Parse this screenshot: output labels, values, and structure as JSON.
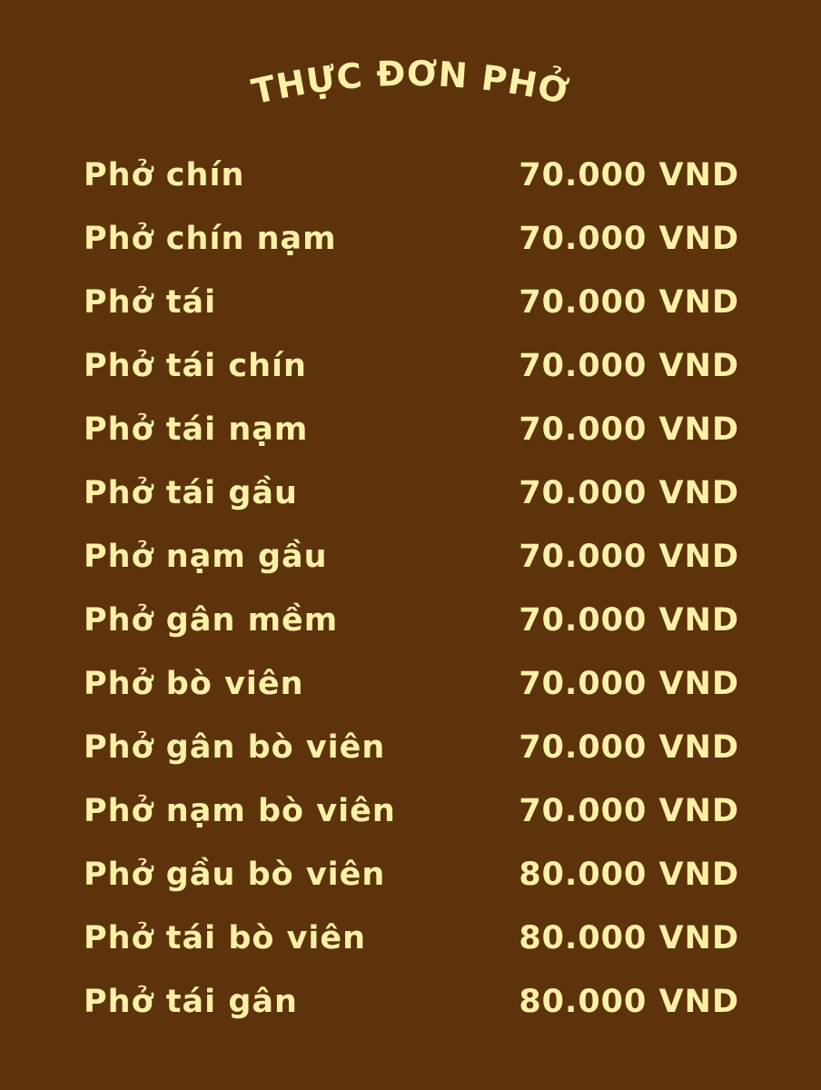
{
  "menu": {
    "title": "THỰC ĐƠN PHỞ",
    "items": [
      {
        "name": "Phở chín",
        "price": "70.000 VND"
      },
      {
        "name": "Phở chín nạm",
        "price": "70.000 VND"
      },
      {
        "name": "Phở tái",
        "price": "70.000 VND"
      },
      {
        "name": "Phở tái chín",
        "price": "70.000 VND"
      },
      {
        "name": "Phở tái nạm",
        "price": "70.000 VND"
      },
      {
        "name": "Phở tái gầu",
        "price": "70.000 VND"
      },
      {
        "name": "Phở nạm gầu",
        "price": "70.000 VND"
      },
      {
        "name": "Phở gân mềm",
        "price": "70.000 VND"
      },
      {
        "name": "Phở bò viên",
        "price": "70.000 VND"
      },
      {
        "name": "Phở gân bò viên",
        "price": "70.000 VND"
      },
      {
        "name": "Phở nạm bò viên",
        "price": "70.000 VND"
      },
      {
        "name": "Phở gầu bò viên",
        "price": "80.000 VND"
      },
      {
        "name": "Phở tái bò viên",
        "price": "80.000 VND"
      },
      {
        "name": "Phở tái gân",
        "price": "80.000 VND"
      }
    ]
  },
  "colors": {
    "background": "#5c330b",
    "text": "#fff0a8"
  }
}
